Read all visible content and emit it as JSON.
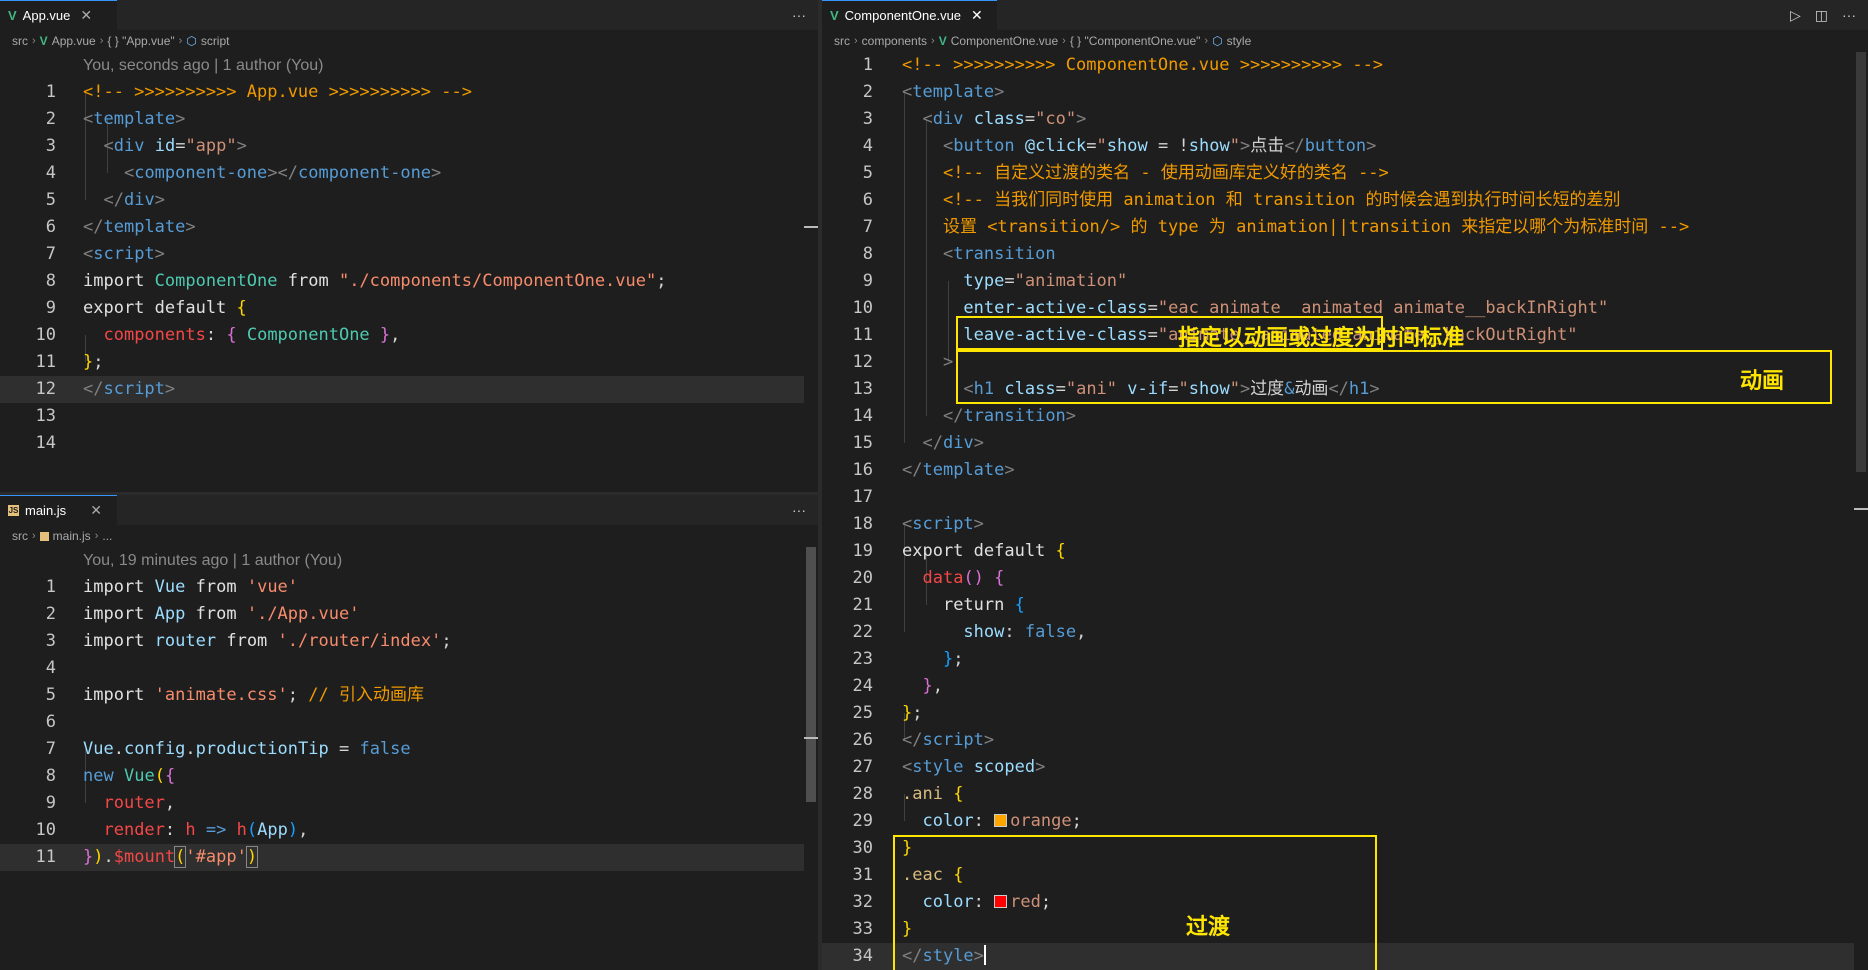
{
  "top_left": {
    "tab": {
      "label": "App.vue",
      "close": "✕"
    },
    "more": "···",
    "breadcrumb": [
      "src",
      "App.vue",
      "{ } \"App.vue\"",
      "script"
    ],
    "blame": "You, seconds ago | 1 author (You)",
    "line_numbers": [
      "1",
      "2",
      "3",
      "4",
      "5",
      "6",
      "7",
      "8",
      "9",
      "10",
      "11",
      "12",
      "13",
      "14"
    ]
  },
  "bottom_left": {
    "tab": {
      "label": "main.js",
      "close": "✕"
    },
    "more": "···",
    "breadcrumb": [
      "src",
      "main.js",
      "..."
    ],
    "blame": "You, 19 minutes ago | 1 author (You)",
    "line_numbers": [
      "1",
      "2",
      "3",
      "4",
      "5",
      "6",
      "7",
      "8",
      "9",
      "10",
      "11"
    ]
  },
  "right": {
    "tab": {
      "label": "ComponentOne.vue",
      "close": "✕"
    },
    "actions": {
      "run": "▷",
      "split": "◫",
      "more": "···"
    },
    "breadcrumb": [
      "src",
      "components",
      "ComponentOne.vue",
      "{ } \"ComponentOne.vue\"",
      "style"
    ],
    "line_numbers": [
      "1",
      "2",
      "3",
      "4",
      "5",
      "6",
      "7",
      "8",
      "9",
      "10",
      "11",
      "12",
      "13",
      "14",
      "15",
      "16",
      "17",
      "18",
      "19",
      "20",
      "21",
      "22",
      "23",
      "24",
      "25",
      "26",
      "27",
      "28",
      "29",
      "30",
      "31",
      "32",
      "33",
      "34"
    ],
    "annotations": {
      "type_note": "指定以动画或过度为时间标准",
      "animation": "动画",
      "transition": "过渡"
    },
    "colors": {
      "orange_swatch": "#ffa500",
      "red_swatch": "#ff0000"
    }
  },
  "theme": {
    "accent": "#ffe600",
    "background": "#1e1e1e"
  }
}
